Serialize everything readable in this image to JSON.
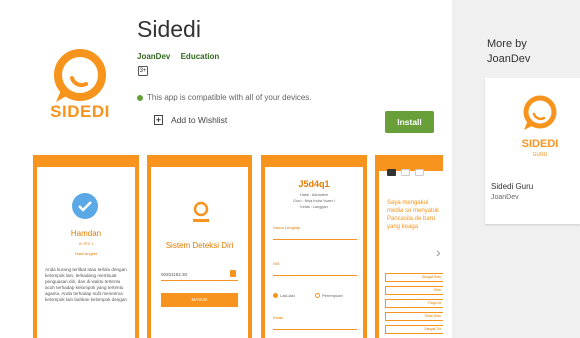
{
  "app": {
    "title": "Sidedi",
    "icon_word": "SIDEDI",
    "developer": "JoanDev",
    "category": "Education",
    "content_rating": "3+",
    "compat_text": "This app is compatible with all of your devices.",
    "wishlist_label": "Add to Wishlist",
    "install_label": "Install"
  },
  "screenshots": {
    "s1": {
      "name": "Hamdan",
      "class": "XI IPS 1",
      "section": "Hasil Angket",
      "text": "Anda kurang terlibat atau terlalu dengan kelompok lain, terkadang membuat penguasan diri, dan di waktu tertentu acuh terhadap kelompok yang tertentu agama. Anda terhadap sulit menerima kelompok lain bahkan kelompok dengan"
    },
    "s2": {
      "title": "Sistem Deteksi Diri",
      "field": "00201193.30",
      "button": "MASUK"
    },
    "s3": {
      "code": "J5d4q1",
      "sub1": "Hafal : Adnadem",
      "sub2": "Guru : Nisa Indra Yuaer I",
      "sub3": "Kelas : Langgan",
      "label1": "Nama Lengkap",
      "label2": "NIS",
      "radio1": "Laki-laki",
      "radio2": "Perempuan",
      "label3": "Kelas"
    },
    "s4": {
      "text": "Saya mengakui media so menyatuk Pancasila de baru yang keaga",
      "options": [
        "Sangat Setu",
        "Setu",
        "Ragu-ra",
        "Tidak Setu",
        "Sangat Tid"
      ]
    }
  },
  "sidebar": {
    "heading_line1": "More by",
    "heading_line2": "JoanDev",
    "card_word": "SIDEDI",
    "card_subword": "GURU",
    "card_title": "Sidedi Guru",
    "card_dev": "JoanDev"
  },
  "colors": {
    "brand_orange": "#f7941d",
    "install_green": "#689f38"
  }
}
